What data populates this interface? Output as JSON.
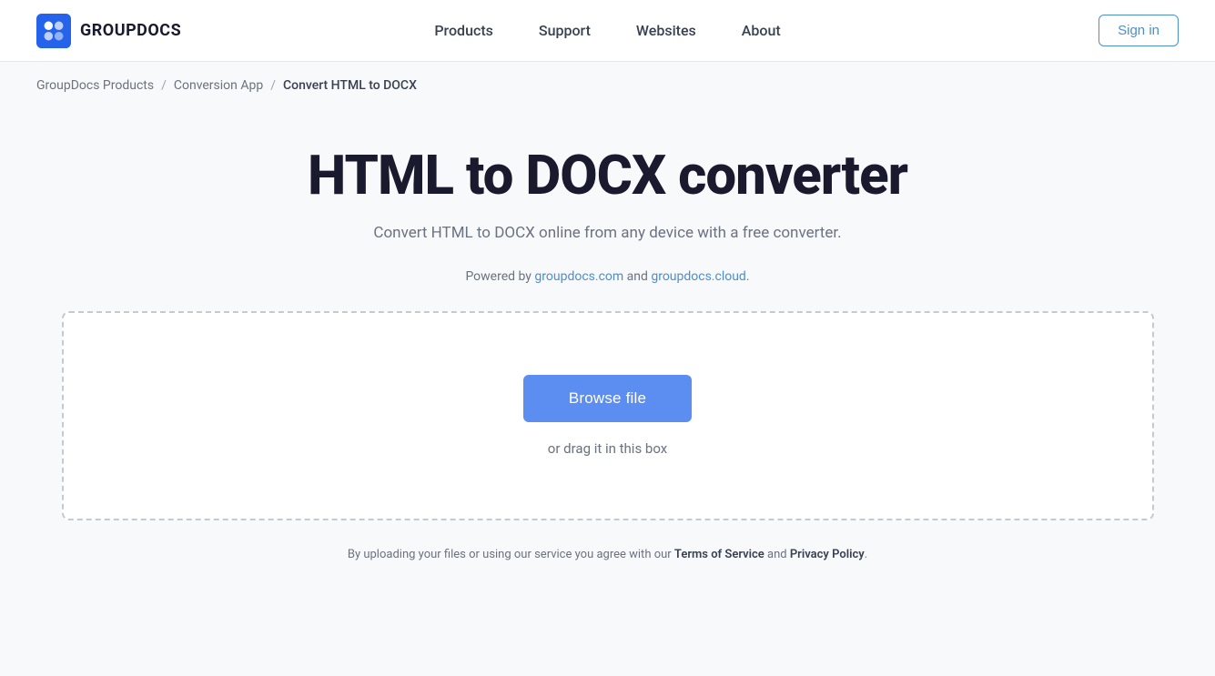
{
  "header": {
    "logo_text": "GROUPDOCS",
    "nav_items": [
      {
        "label": "Products",
        "href": "#"
      },
      {
        "label": "Support",
        "href": "#"
      },
      {
        "label": "Websites",
        "href": "#"
      },
      {
        "label": "About",
        "href": "#"
      }
    ],
    "sign_in_label": "Sign in"
  },
  "breadcrumb": {
    "items": [
      {
        "label": "GroupDocs Products",
        "href": "#"
      },
      {
        "label": "Conversion App",
        "href": "#"
      },
      {
        "label": "Convert HTML to DOCX",
        "current": true
      }
    ],
    "separator": "/"
  },
  "main": {
    "title": "HTML to DOCX converter",
    "subtitle": "Convert HTML to DOCX online from any device with a free converter.",
    "powered_by_prefix": "Powered by ",
    "powered_by_link1_text": "groupdocs.com",
    "powered_by_link1_href": "#",
    "powered_by_and": " and ",
    "powered_by_link2_text": "groupdocs.cloud",
    "powered_by_link2_href": "#",
    "powered_by_suffix": ".",
    "browse_file_label": "Browse file",
    "drag_text": "or drag it in this box"
  },
  "footer": {
    "note_prefix": "By uploading your files or using our service you agree with our ",
    "tos_label": "Terms of Service",
    "tos_href": "#",
    "and_text": " and ",
    "privacy_label": "Privacy Policy",
    "privacy_href": "#",
    "note_suffix": "."
  },
  "colors": {
    "accent_blue": "#5b8ef0",
    "link_blue": "#4a8fd1",
    "border_dashed": "#c5c9d0"
  }
}
